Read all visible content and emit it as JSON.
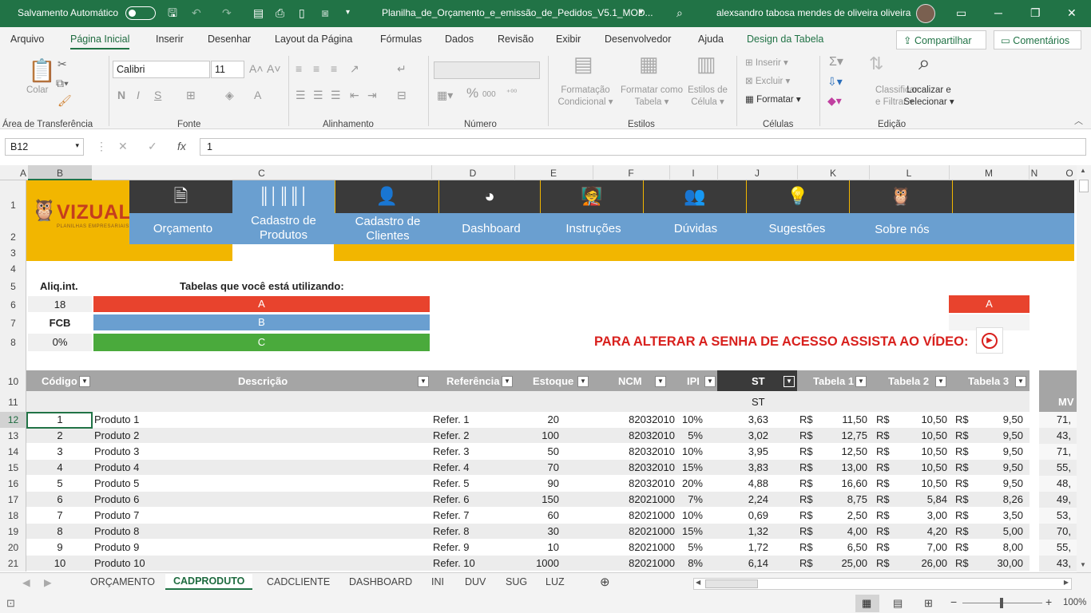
{
  "titlebar": {
    "autosave": "Salvamento Automático",
    "filename": "Planilha_de_Orçamento_e_emissão_de_Pedidos_V5.1_MOD...",
    "user": "alexsandro tabosa mendes de oliveira oliveira"
  },
  "menu": [
    "Arquivo",
    "Página Inicial",
    "Inserir",
    "Desenhar",
    "Layout da Página",
    "Fórmulas",
    "Dados",
    "Revisão",
    "Exibir",
    "Desenvolvedor",
    "Ajuda",
    "Design da Tabela"
  ],
  "share": "Compartilhar",
  "comments": "Comentários",
  "ribbon": {
    "paste": "Colar",
    "font": "Calibri",
    "size": "11",
    "groups": [
      "Área de Transferência",
      "Fonte",
      "Alinhamento",
      "Número",
      "Estilos",
      "Células",
      "Edição"
    ],
    "cond": [
      "Formatação",
      "Condicional"
    ],
    "astable": [
      "Formatar como",
      "Tabela"
    ],
    "cellstyles": [
      "Estilos de",
      "Célula"
    ],
    "insert": "Inserir",
    "delete": "Excluir",
    "format": "Formatar",
    "sort": [
      "Classificar",
      "e Filtrar"
    ],
    "find": [
      "Localizar e",
      "Selecionar"
    ]
  },
  "namebox": "B12",
  "formula": "1",
  "columns": [
    "A",
    "B",
    "C",
    "D",
    "E",
    "F",
    "I",
    "J",
    "K",
    "L",
    "M",
    "N",
    "O"
  ],
  "rows": [
    "1",
    "2",
    "3",
    "4",
    "5",
    "6",
    "7",
    "8",
    "10",
    "11",
    "12",
    "13",
    "14",
    "15",
    "16",
    "17",
    "18",
    "19",
    "20",
    "21"
  ],
  "logo": {
    "name": "VIZUAL",
    "tag": "PLANILHAS EMPRESARIAIS"
  },
  "nav": [
    {
      "label": "Orçamento",
      "icon": "doc-icon"
    },
    {
      "label": "Cadastro de Produtos",
      "icon": "barcode-icon"
    },
    {
      "label": "Cadastro de Clientes",
      "icon": "user-icon"
    },
    {
      "label": "Dashboard",
      "icon": "pie-icon"
    },
    {
      "label": "Instruções",
      "icon": "teacher-icon"
    },
    {
      "label": "Dúvidas",
      "icon": "question-icon"
    },
    {
      "label": "Sugestões",
      "icon": "bulb-icon"
    },
    {
      "label": "Sobre nós",
      "icon": "owl-icon"
    }
  ],
  "info": {
    "aliq_label": "Aliq.int.",
    "aliq_value": "18",
    "fcb_label": "FCB",
    "fcb_value": "0%",
    "tables_label": "Tabelas que você está utilizando:",
    "tables": [
      "A",
      "B",
      "C"
    ],
    "right_band": "A",
    "video_text": "PARA ALTERAR A SENHA DE ACESSO ASSISTA AO VÍDEO:"
  },
  "colors": {
    "red": "#e8432d",
    "blue": "#6a9fd0",
    "green": "#4aaa3c",
    "gold": "#f2b600",
    "dark": "#3a3a3a",
    "excel": "#217346"
  },
  "table": {
    "headers": [
      "Código",
      "Descrição",
      "Referência",
      "Estoque",
      "NCM",
      "IPI",
      "ST",
      "Tabela 1",
      "Tabela 2",
      "Tabela 3"
    ],
    "subheader": "ST",
    "extra_header": "MV",
    "currency": "R$",
    "data": [
      [
        "1",
        "Produto 1",
        "Refer. 1",
        "20",
        "82032010",
        "10%",
        "3,63",
        "11,50",
        "10,50",
        "9,50",
        "71,"
      ],
      [
        "2",
        "Produto 2",
        "Refer. 2",
        "100",
        "82032010",
        "5%",
        "3,02",
        "12,75",
        "10,50",
        "9,50",
        "43,"
      ],
      [
        "3",
        "Produto 3",
        "Refer. 3",
        "50",
        "82032010",
        "10%",
        "3,95",
        "12,50",
        "10,50",
        "9,50",
        "71,"
      ],
      [
        "4",
        "Produto 4",
        "Refer. 4",
        "70",
        "82032010",
        "15%",
        "3,83",
        "13,00",
        "10,50",
        "9,50",
        "55,"
      ],
      [
        "5",
        "Produto 5",
        "Refer. 5",
        "90",
        "82032010",
        "20%",
        "4,88",
        "16,60",
        "10,50",
        "9,50",
        "48,"
      ],
      [
        "6",
        "Produto 6",
        "Refer. 6",
        "150",
        "82021000",
        "7%",
        "2,24",
        "8,75",
        "5,84",
        "8,26",
        "49,"
      ],
      [
        "7",
        "Produto 7",
        "Refer. 7",
        "60",
        "82021000",
        "10%",
        "0,69",
        "2,50",
        "3,00",
        "3,50",
        "53,"
      ],
      [
        "8",
        "Produto 8",
        "Refer. 8",
        "30",
        "82021000",
        "15%",
        "1,32",
        "4,00",
        "4,20",
        "5,00",
        "70,"
      ],
      [
        "9",
        "Produto 9",
        "Refer. 9",
        "10",
        "82021000",
        "5%",
        "1,72",
        "6,50",
        "7,00",
        "8,00",
        "55,"
      ],
      [
        "10",
        "Produto 10",
        "Refer. 10",
        "1000",
        "82021000",
        "8%",
        "6,14",
        "25,00",
        "26,00",
        "30,00",
        "43,"
      ]
    ]
  },
  "sheets": [
    "ORÇAMENTO",
    "CADPRODUTO",
    "CADCLIENTE",
    "DASHBOARD",
    "INI",
    "DUV",
    "SUG",
    "LUZ"
  ],
  "zoom": "100%"
}
